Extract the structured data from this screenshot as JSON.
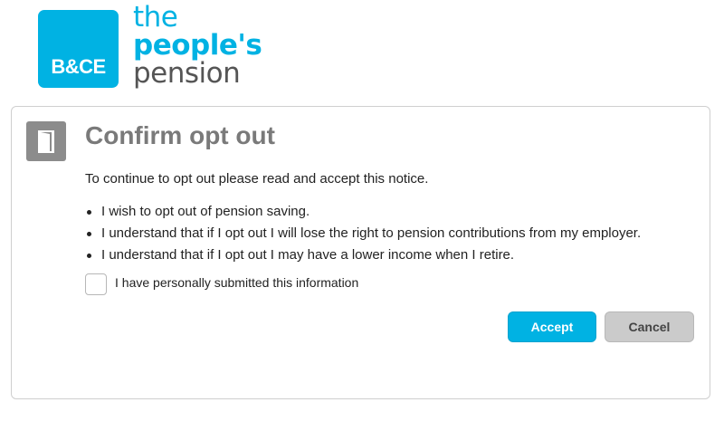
{
  "header": {
    "logo_box_text": "B&CE",
    "brand_line1": "the",
    "brand_line2": "people's",
    "brand_line3": "pension",
    "brand_color": "#00b2e3"
  },
  "dialog": {
    "icon": "door-icon",
    "title": "Confirm opt out",
    "intro": "To continue to opt out please read and accept this notice.",
    "bullets": [
      "I wish to opt out of pension saving.",
      "I understand that if I opt out I will lose the right to pension contributions from my employer.",
      "I understand that if I opt out I may have a lower income when I retire."
    ],
    "checkbox_label": "I have personally submitted this information",
    "checkbox_checked": false,
    "accept_label": "Accept",
    "cancel_label": "Cancel",
    "accept_color": "#00b2e3",
    "cancel_color": "#cbcbcb"
  }
}
